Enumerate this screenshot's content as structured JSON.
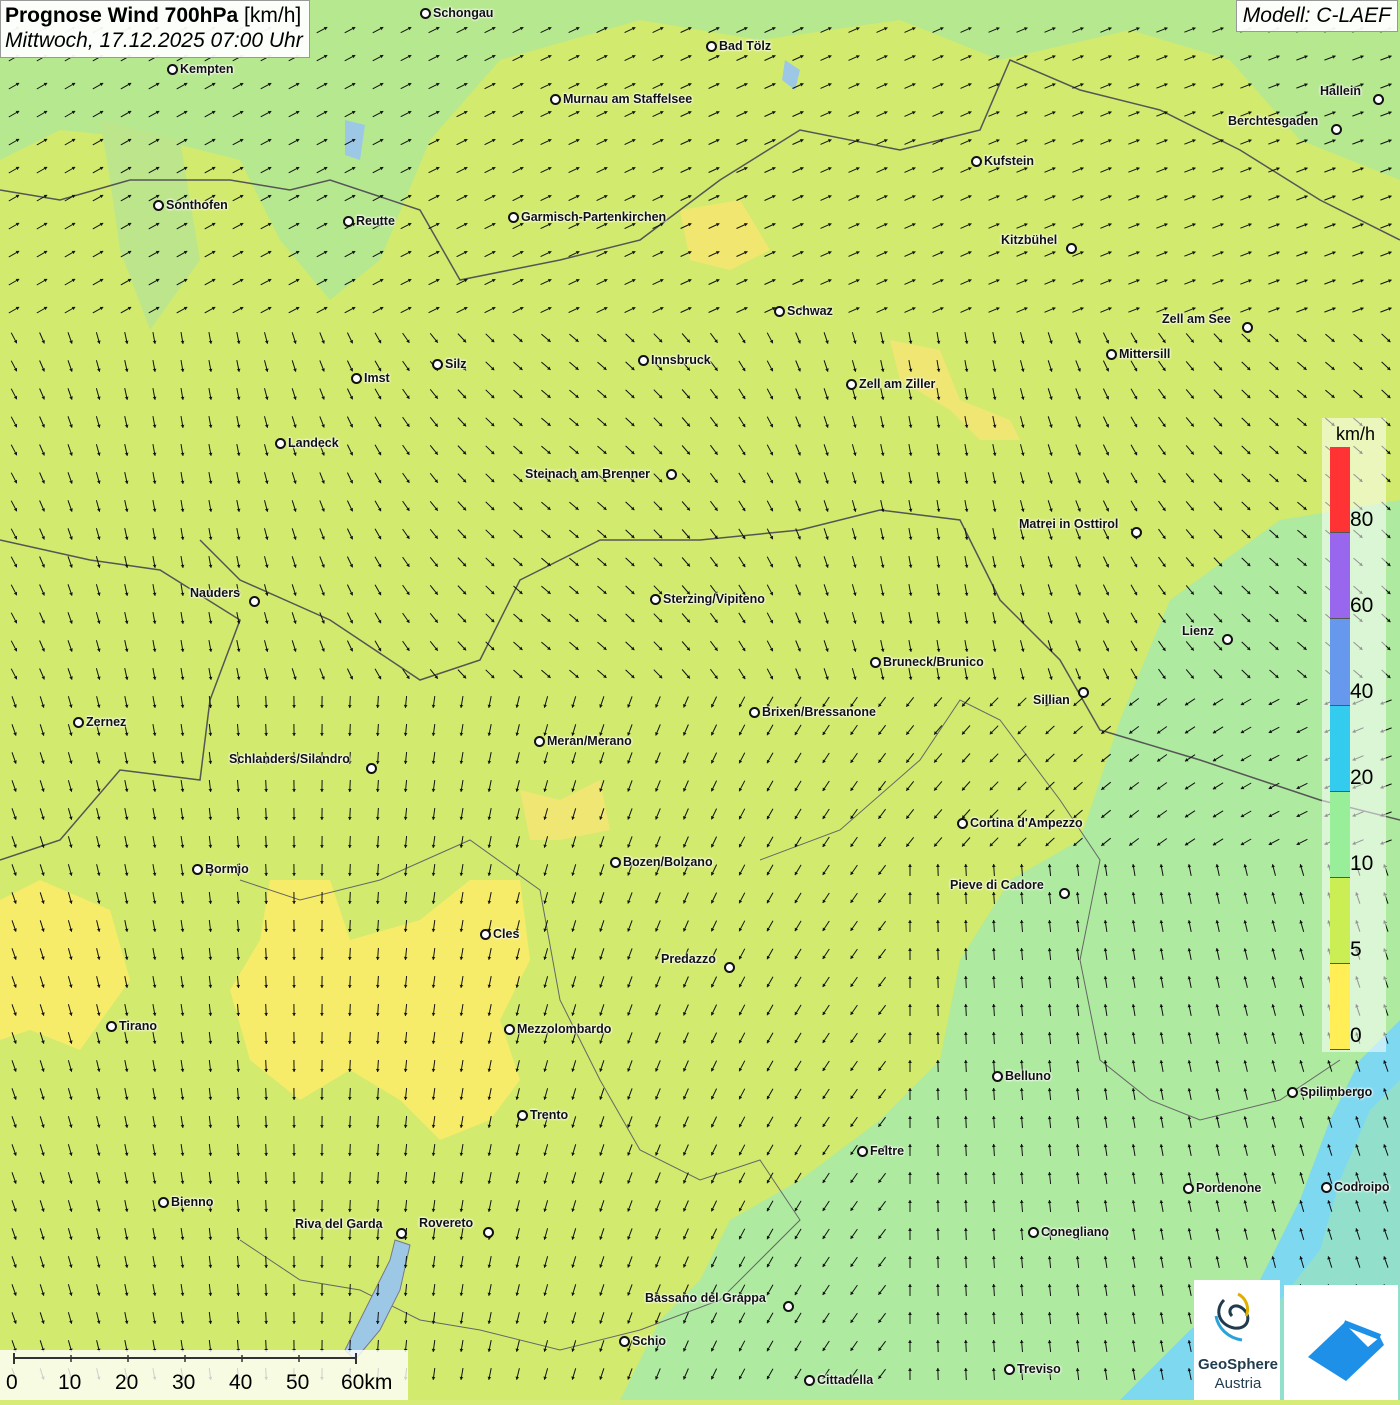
{
  "title": {
    "main": "Prognose Wind 700hPa",
    "unit": "[km/h]",
    "subtitle": "Mittwoch, 17.12.2025 07:00 Uhr"
  },
  "model": "Modell: C-LAEF",
  "legend": {
    "unit": "km/h",
    "ticks": [
      "80",
      "60",
      "40",
      "20",
      "10",
      "5",
      "0"
    ],
    "colors": [
      "#ff3333",
      "#9966ee",
      "#6699ee",
      "#33ccee",
      "#99ee99",
      "#ccee55",
      "#ffee55"
    ]
  },
  "scale_bar": {
    "labels": [
      "0",
      "10",
      "20",
      "30",
      "40",
      "50",
      "60km"
    ]
  },
  "logo": {
    "name_line1": "GeoSphere",
    "name_line2": "Austria"
  },
  "cities": [
    {
      "name": "Schongau"
    },
    {
      "name": "Bad Tölz"
    },
    {
      "name": "Kempten"
    },
    {
      "name": "Murnau am Staffelsee"
    },
    {
      "name": "Hallein"
    },
    {
      "name": "Berchtesgaden"
    },
    {
      "name": "Kufstein"
    },
    {
      "name": "Sonthofen"
    },
    {
      "name": "Reutte"
    },
    {
      "name": "Garmisch-Partenkirchen"
    },
    {
      "name": "Kitzbühel"
    },
    {
      "name": "Schwaz"
    },
    {
      "name": "Zell am See"
    },
    {
      "name": "Mittersill"
    },
    {
      "name": "Silz"
    },
    {
      "name": "Innsbruck"
    },
    {
      "name": "Imst"
    },
    {
      "name": "Zell am Ziller"
    },
    {
      "name": "Landeck"
    },
    {
      "name": "Steinach am Brenner"
    },
    {
      "name": "Matrei in Osttirol"
    },
    {
      "name": "Nauders"
    },
    {
      "name": "Sterzing/Vipiteno"
    },
    {
      "name": "Lienz"
    },
    {
      "name": "Bruneck/Brunico"
    },
    {
      "name": "Sillian"
    },
    {
      "name": "Brixen/Bressanone"
    },
    {
      "name": "Zernez"
    },
    {
      "name": "Meran/Merano"
    },
    {
      "name": "Schlanders/Silandro"
    },
    {
      "name": "Cortina d'Ampezzo"
    },
    {
      "name": "Bozen/Bolzano"
    },
    {
      "name": "Bormio"
    },
    {
      "name": "Pieve di Cadore"
    },
    {
      "name": "Cles"
    },
    {
      "name": "Predazzo"
    },
    {
      "name": "Tirano"
    },
    {
      "name": "Mezzolombardo"
    },
    {
      "name": "Belluno"
    },
    {
      "name": "Spilimbergo"
    },
    {
      "name": "Trento"
    },
    {
      "name": "Feltre"
    },
    {
      "name": "Pordenone"
    },
    {
      "name": "Codroipo"
    },
    {
      "name": "Bienno"
    },
    {
      "name": "Riva del Garda"
    },
    {
      "name": "Rovereto"
    },
    {
      "name": "Conegliano"
    },
    {
      "name": "Bassano del Grappa"
    },
    {
      "name": "Schio"
    },
    {
      "name": "Treviso"
    },
    {
      "name": "Cittadella"
    }
  ]
}
